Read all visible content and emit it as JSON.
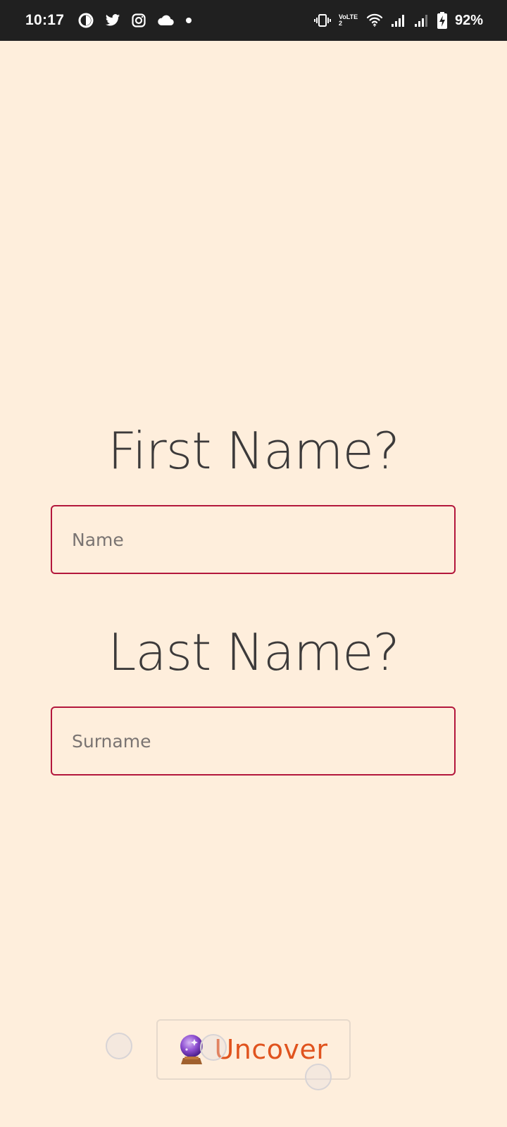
{
  "status_bar": {
    "time": "10:17",
    "battery_percent": "92%",
    "network_label": "VoLTE2",
    "left_icons": [
      "data-saver-icon",
      "twitter-icon",
      "instagram-icon",
      "cloud-icon",
      "dot-icon"
    ],
    "right_icons": [
      "vibrate-icon",
      "volte-icon",
      "wifi-icon",
      "signal-icon",
      "signal-icon",
      "battery-charging-icon"
    ]
  },
  "form": {
    "first_name_title": "First Name?",
    "first_name_placeholder": "Name",
    "last_name_title": "Last Name?",
    "last_name_placeholder": "Surname"
  },
  "action": {
    "button_label": "Uncover",
    "button_icon": "crystal-ball-icon"
  },
  "colors": {
    "background": "#FEEEDC",
    "status_bar": "#202020",
    "input_border": "#B3173C",
    "title_text": "#3C3A3A",
    "button_text": "#E0531E"
  }
}
